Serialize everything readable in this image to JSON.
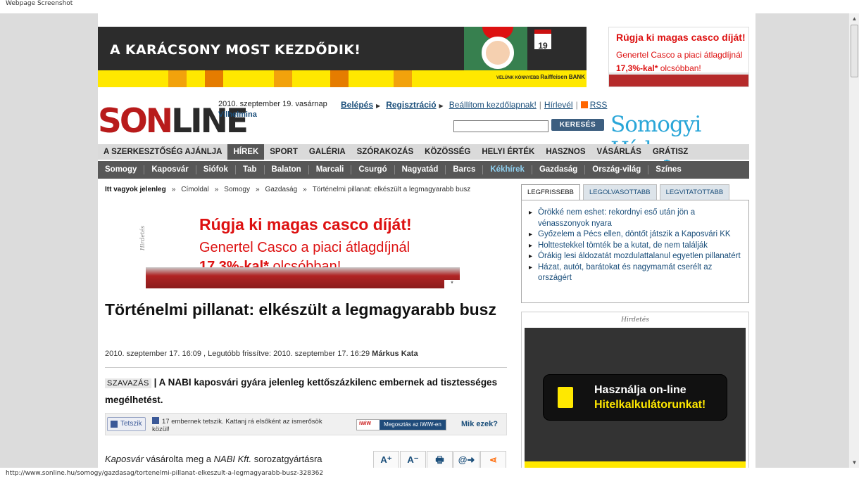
{
  "caption": "Webpage Screenshot",
  "status_url": "http://www.sonline.hu/somogy/gazdasag/tortenelmi-pillanat-elkeszult-a-legmagyarabb-busz-328362",
  "banner_xmas": {
    "text": "A KARÁCSONY MOST KEZDŐDIK!",
    "calendar_day": "19",
    "bank_small": "VELÜNK KÖNNYEBB",
    "bank_name": "Raiffeisen BANK"
  },
  "banner_casco": {
    "line1": "Rúgja ki magas casco díját!",
    "line2": "Genertel Casco a piaci átlagdíjnál",
    "line3_bold": "17,3%-kal*",
    "line3_rest": " olcsóbban!"
  },
  "logo": {
    "part1": "SON",
    "part2": "LINE"
  },
  "header": {
    "date": "2010. szeptember 19. vasárnap",
    "nameday": "Vilhelmina",
    "links": {
      "login": "Belépés",
      "register": "Regisztráció",
      "homepage": "Beállítom kezdőlapnak!",
      "newsletter": "Hírlevél",
      "rss": "RSS"
    },
    "search_button": "KERESÉS",
    "search_value": "",
    "brand": "Somogyi Hírlap"
  },
  "nav_main": [
    "A SZERKESZTŐSÉG AJÁNLJA",
    "HÍREK",
    "SPORT",
    "GALÉRIA",
    "SZÓRAKOZÁS",
    "KÖZÖSSÉG",
    "HELYI ÉRTÉK",
    "HASZNOS",
    "VÁSÁRLÁS",
    "GRÁTISZ"
  ],
  "nav_sub": [
    "Somogy",
    "Kaposvár",
    "Siófok",
    "Tab",
    "Balaton",
    "Marcali",
    "Csurgó",
    "Nagyatád",
    "Barcs",
    "Kékhírek",
    "Gazdaság",
    "Ország-világ",
    "Színes"
  ],
  "breadcrumb": {
    "label": "Itt vagyok jelenleg",
    "items": [
      "Címoldal",
      "Somogy",
      "Gazdaság",
      "Történelmi pillanat: elkészült a legmagyarabb busz"
    ]
  },
  "ad_label": "Hirdetés",
  "article": {
    "title": "Történelmi pillanat: elkészült a legmagyarabb busz",
    "meta": "2010. szeptember 17. 16:09 , Legutóbb frissítve: 2010. szeptember 17. 16:29",
    "author": "Márkus Kata",
    "lead_tag": "SZAVAZÁS",
    "lead": "| A NABI kaposvári gyára jelenleg kettőszázkilenc embernek ad tisztességes megélhetést.",
    "like_label": "Tetszik",
    "fb_text": "17 embernek tetszik. Kattanj rá elsőként az ismerősök közül!",
    "iwiw_label": "Megosztás az iWiW-en",
    "iwiw_logo": "iWiW",
    "what_label": "Mik ezek?",
    "body_start_1": "Kaposvár",
    "body_start_2": " vásárolta meg a ",
    "body_start_3": "NABI Kft.",
    "body_start_4": " sorozatgyártásra",
    "tools": [
      "A⁺",
      "A⁻",
      "🖶",
      "@➜",
      "⋖"
    ]
  },
  "right_tabs": [
    "LEGFRISSEBB",
    "LEGOLVASOTTABB",
    "LEGVITATOTTABB"
  ],
  "right_news": [
    "Örökké nem eshet: rekordnyi eső után jön a vénasszonyok nyara",
    "Győzelem a Pécs ellen, döntőt játszik a Kaposvári KK",
    "Holttestekkel tömték be a kutat, de nem találják",
    "Órákig lesi áldozatát mozdulattalanul egyetlen pillanatért",
    "Házat, autót, barátokat és nagymamát cserélt az országért"
  ],
  "right_ad": {
    "line1": "Használja on-line",
    "line2": "Hitelkalkulátorunkat!"
  }
}
